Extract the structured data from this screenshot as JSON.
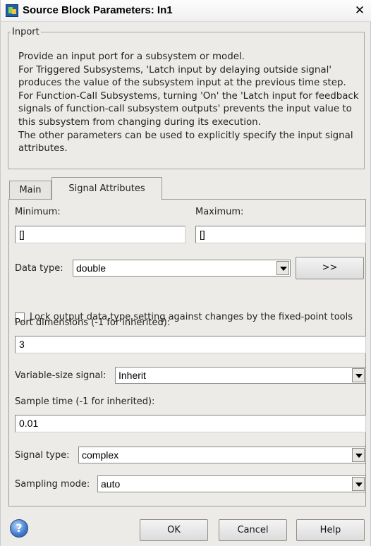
{
  "window": {
    "title": "Source Block Parameters: In1",
    "close_glyph": "✕"
  },
  "group": {
    "label": "Inport",
    "description": "Provide an input port for a subsystem or model.\nFor Triggered Subsystems, 'Latch input by delaying outside signal' produces the value of the subsystem input at the previous time step.\nFor Function-Call Subsystems, turning 'On' the 'Latch input for feedback signals of function-call subsystem outputs' prevents the input value to this subsystem from changing during its execution.\nThe other parameters can be used to explicitly specify the input signal attributes."
  },
  "tabs": [
    {
      "label": "Main",
      "active": false
    },
    {
      "label": "Signal Attributes",
      "active": true
    }
  ],
  "fields": {
    "minimum": {
      "label": "Minimum:",
      "value": "[]"
    },
    "maximum": {
      "label": "Maximum:",
      "value": "[]"
    },
    "data_type": {
      "label": "Data type:",
      "value": "double"
    },
    "assistant_button": ">>",
    "lock_checkbox": {
      "label": "Lock output data type setting against changes by the fixed-point tools",
      "checked": false
    },
    "port_dimensions": {
      "label": "Port dimensions (-1 for inherited):",
      "value": "3"
    },
    "variable_size": {
      "label": "Variable-size signal:",
      "value": "Inherit"
    },
    "sample_time": {
      "label": "Sample time (-1 for inherited):",
      "value": "0.01"
    },
    "signal_type": {
      "label": "Signal type:",
      "value": "complex"
    },
    "sampling_mode": {
      "label": "Sampling mode:",
      "value": "auto"
    }
  },
  "buttons": {
    "help_glyph": "?",
    "ok": "OK",
    "cancel": "Cancel",
    "help": "Help"
  },
  "icons": {
    "window": "simulink-block-icon",
    "close": "close-icon",
    "help": "help-icon",
    "dropdown": "chevron-down-icon"
  }
}
